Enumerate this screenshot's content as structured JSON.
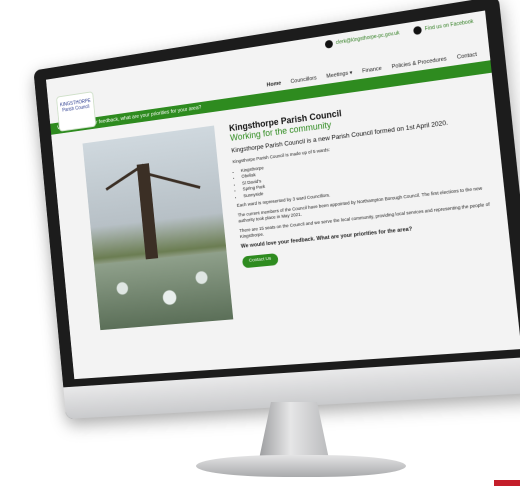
{
  "topbar": {
    "email": "clerk@kingsthorpe-pc.gov.uk",
    "facebook": "Find us on Facebook"
  },
  "logo": {
    "line1": "KINGSTHORPE",
    "line2": "Parish Council"
  },
  "nav": {
    "items": [
      "Home",
      "Councillors",
      "Meetings ▾",
      "Finance",
      "Policies & Procedures",
      "Contact"
    ]
  },
  "banner": {
    "text": "We would love your feedback, what are your priorities for your area?"
  },
  "hero": {
    "title": "Kingsthorpe Parish Council",
    "subtitle": "Working for the community",
    "formed": "Kingsthorpe Parish Council is a new Parish Council formed on 1st April 2020.",
    "wards_intro": "Kingsthorpe Parish Council is made up of 5 wards:",
    "wards": [
      "Kingsthorpe",
      "Obelisk",
      "St David's",
      "Spring Park",
      "Sunnyside"
    ],
    "p1": "Each ward is represented by 3 ward Councillors.",
    "p2": "The current members of the Council have been appointed by Northampton Borough Council. The first elections to the new authority took place in May 2021.",
    "p3": "There are 15 seats on the Council and we serve the local community, providing local services and representing the people of Kingsthorpe.",
    "feedback": "We would love your feedback. What are your priorities for the area?",
    "button": "Contact Us"
  },
  "colors": {
    "brand_green": "#2e8b1f",
    "bezel": "#1c1c1c"
  }
}
